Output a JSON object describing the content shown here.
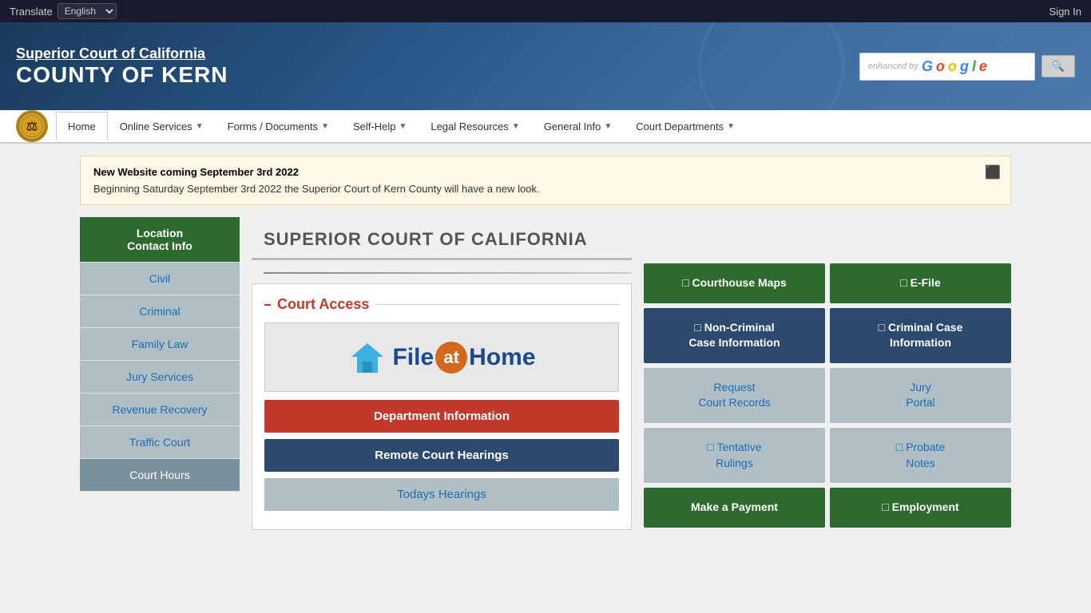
{
  "topbar": {
    "translate_label": "Translate",
    "language_default": "English",
    "sign_in": "Sign In"
  },
  "header": {
    "line1": "Superior Court of California",
    "line2": "COUNTY OF KERN",
    "search_placeholder": "enhanced by Google",
    "search_btn": "🔍"
  },
  "nav": {
    "items": [
      {
        "label": "Home",
        "active": true,
        "dropdown": false
      },
      {
        "label": "Online Services",
        "active": false,
        "dropdown": true
      },
      {
        "label": "Forms / Documents",
        "active": false,
        "dropdown": true
      },
      {
        "label": "Self-Help",
        "active": false,
        "dropdown": true
      },
      {
        "label": "Legal Resources",
        "active": false,
        "dropdown": true
      },
      {
        "label": "General Info",
        "active": false,
        "dropdown": true
      },
      {
        "label": "Court Departments",
        "active": false,
        "dropdown": true
      }
    ]
  },
  "announcement": {
    "title": "New Website coming September 3rd 2022",
    "body": "Beginning Saturday September 3rd 2022 the Superior Court of Kern County will have a new look."
  },
  "sidebar": {
    "items": [
      {
        "label": "Location\nContact Info",
        "style": "active"
      },
      {
        "label": "Civil",
        "style": "light"
      },
      {
        "label": "Criminal",
        "style": "light"
      },
      {
        "label": "Family Law",
        "style": "light"
      },
      {
        "label": "Jury Services",
        "style": "light"
      },
      {
        "label": "Revenue Recovery",
        "style": "light"
      },
      {
        "label": "Traffic Court",
        "style": "light"
      },
      {
        "label": "Court Hours",
        "style": "dark"
      }
    ]
  },
  "main": {
    "section_title": "SUPERIOR COURT OF CALIFORNIA"
  },
  "court_access": {
    "title": "Court Access",
    "file_at_home": {
      "text_before": "File",
      "at": "at",
      "text_after": "Home"
    },
    "buttons": [
      {
        "label": "Department Information",
        "style": "red"
      },
      {
        "label": "Remote Court Hearings",
        "style": "dark-blue"
      },
      {
        "label": "Todays Hearings",
        "style": "light-blue-text"
      }
    ]
  },
  "right_grid": {
    "buttons": [
      {
        "label": "□ Courthouse Maps",
        "style": "green",
        "col": 1
      },
      {
        "label": "□ E-File",
        "style": "green",
        "col": 2
      },
      {
        "label": "□ Non-Criminal\nCase Information",
        "style": "dark-slate",
        "col": 1
      },
      {
        "label": "□ Criminal Case\nInformation",
        "style": "dark-slate",
        "col": 2
      },
      {
        "label": "Request\nCourt Records",
        "style": "steel",
        "col": 1
      },
      {
        "label": "Jury\nPortal",
        "style": "steel",
        "col": 2
      },
      {
        "label": "□ Tentative\nRulings",
        "style": "steel",
        "col": 1
      },
      {
        "label": "□ Probate\nNotes",
        "style": "steel",
        "col": 2
      },
      {
        "label": "Make a Payment",
        "style": "green",
        "col": 1
      },
      {
        "label": "□ Employment",
        "style": "green",
        "col": 2
      }
    ]
  }
}
